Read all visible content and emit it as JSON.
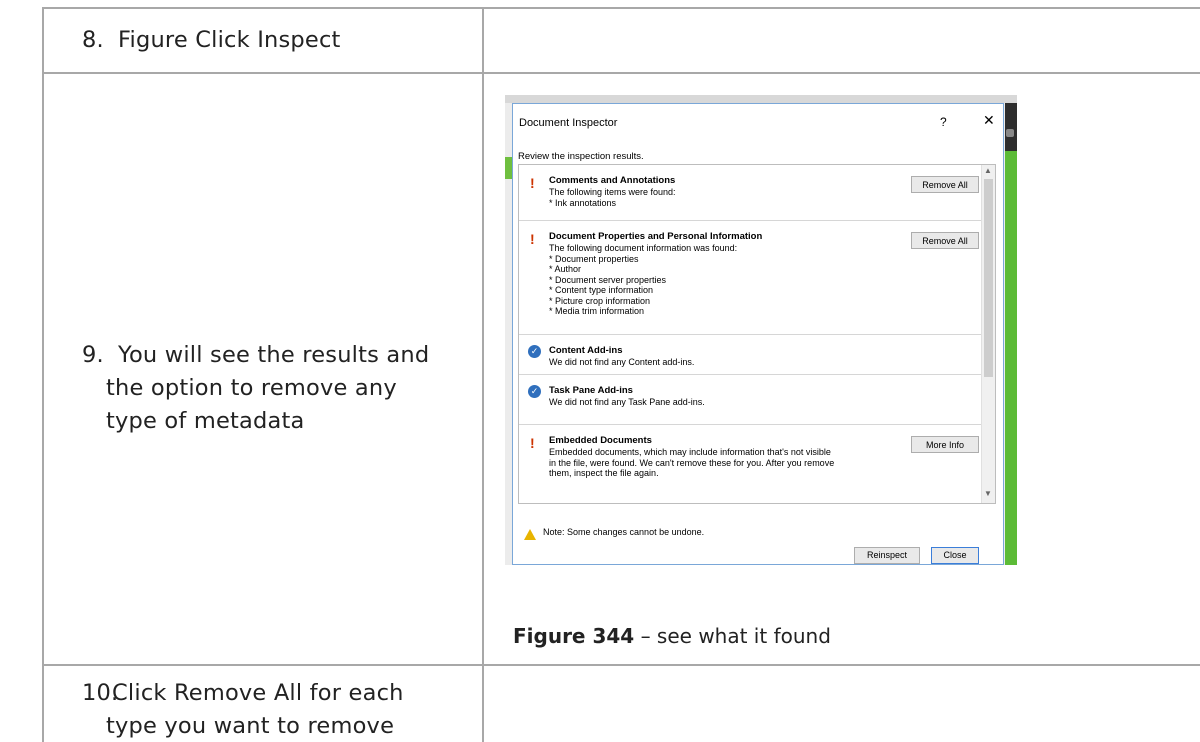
{
  "steps": [
    {
      "num": "8.",
      "lines": [
        "Figure Click Inspect"
      ]
    },
    {
      "num": "9.",
      "lines": [
        "You will see the results and",
        "the option to remove any",
        "type of metadata"
      ]
    },
    {
      "num": "10.",
      "lines": [
        "Click Remove All for each",
        "type you want to remove"
      ]
    }
  ],
  "caption": {
    "label": "Figure 344",
    "text": " – see what it found"
  },
  "dialog": {
    "title": "Document Inspector",
    "help": "?",
    "close_glyph": "✕",
    "subtitle": "Review the inspection results.",
    "sections": [
      {
        "heading": "Comments and Annotations",
        "status": "!",
        "body": "The following items were found:\n* Ink annotations",
        "button": "Remove All"
      },
      {
        "heading": "Document Properties and Personal Information",
        "status": "!",
        "body": "The following document information was found:\n* Document properties\n* Author\n* Document server properties\n* Content type information\n* Picture crop information\n* Media trim information",
        "button": "Remove All"
      },
      {
        "heading": "Content Add-ins",
        "status": "✓",
        "body": "We did not find any Content add-ins.",
        "button": ""
      },
      {
        "heading": "Task Pane Add-ins",
        "status": "✓",
        "body": "We did not find any Task Pane add-ins.",
        "button": ""
      },
      {
        "heading": "Embedded Documents",
        "status": "!",
        "body": "Embedded documents, which may include information that's not visible\nin the file, were found. We can't remove these for you. After you remove\nthem, inspect the file again.",
        "button": "More Info"
      }
    ],
    "note": "Note: Some changes cannot be undone.",
    "reinspect": "Reinspect",
    "close": "Close"
  }
}
